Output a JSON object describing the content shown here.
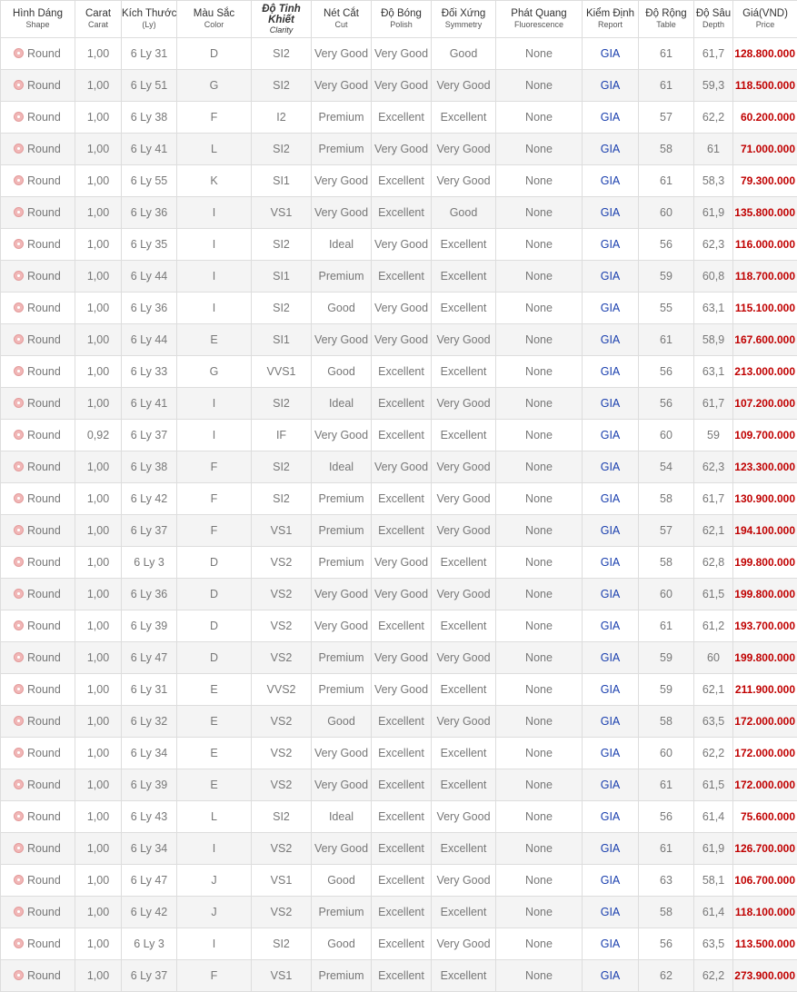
{
  "header": [
    {
      "main": "Hình Dáng",
      "sub": "Shape"
    },
    {
      "main": "Carat",
      "sub": "Carat"
    },
    {
      "main": "Kích Thước",
      "sub": "(Ly)"
    },
    {
      "main": "Màu Sắc",
      "sub": "Color"
    },
    {
      "main": "Độ Tinh Khiết",
      "sub": "Clarity"
    },
    {
      "main": "Nét Cắt",
      "sub": "Cut"
    },
    {
      "main": "Độ Bóng",
      "sub": "Polish"
    },
    {
      "main": "Đối Xứng",
      "sub": "Symmetry"
    },
    {
      "main": "Phát Quang",
      "sub": "Fluorescence"
    },
    {
      "main": "Kiểm Định",
      "sub": "Report"
    },
    {
      "main": "Độ Rộng",
      "sub": "Table"
    },
    {
      "main": "Độ Sâu",
      "sub": "Depth"
    },
    {
      "main": "Giá(VND)",
      "sub": "Price"
    }
  ],
  "rows": [
    {
      "shape": "Round",
      "carat": "1,00",
      "size": "6 Ly 31",
      "color": "D",
      "clarity": "SI2",
      "cut": "Very Good",
      "polish": "Very Good",
      "symmetry": "Good",
      "fluorescence": "None",
      "report": "GIA",
      "table": "61",
      "depth": "61,7",
      "price": "128.800.000"
    },
    {
      "shape": "Round",
      "carat": "1,00",
      "size": "6 Ly 51",
      "color": "G",
      "clarity": "SI2",
      "cut": "Very Good",
      "polish": "Very Good",
      "symmetry": "Very Good",
      "fluorescence": "None",
      "report": "GIA",
      "table": "61",
      "depth": "59,3",
      "price": "118.500.000"
    },
    {
      "shape": "Round",
      "carat": "1,00",
      "size": "6 Ly 38",
      "color": "F",
      "clarity": "I2",
      "cut": "Premium",
      "polish": "Excellent",
      "symmetry": "Excellent",
      "fluorescence": "None",
      "report": "GIA",
      "table": "57",
      "depth": "62,2",
      "price": "60.200.000"
    },
    {
      "shape": "Round",
      "carat": "1,00",
      "size": "6 Ly 41",
      "color": "L",
      "clarity": "SI2",
      "cut": "Premium",
      "polish": "Very Good",
      "symmetry": "Very Good",
      "fluorescence": "None",
      "report": "GIA",
      "table": "58",
      "depth": "61",
      "price": "71.000.000"
    },
    {
      "shape": "Round",
      "carat": "1,00",
      "size": "6 Ly 55",
      "color": "K",
      "clarity": "SI1",
      "cut": "Very Good",
      "polish": "Excellent",
      "symmetry": "Very Good",
      "fluorescence": "None",
      "report": "GIA",
      "table": "61",
      "depth": "58,3",
      "price": "79.300.000"
    },
    {
      "shape": "Round",
      "carat": "1,00",
      "size": "6 Ly 36",
      "color": "I",
      "clarity": "VS1",
      "cut": "Very Good",
      "polish": "Excellent",
      "symmetry": "Good",
      "fluorescence": "None",
      "report": "GIA",
      "table": "60",
      "depth": "61,9",
      "price": "135.800.000"
    },
    {
      "shape": "Round",
      "carat": "1,00",
      "size": "6 Ly 35",
      "color": "I",
      "clarity": "SI2",
      "cut": "Ideal",
      "polish": "Very Good",
      "symmetry": "Excellent",
      "fluorescence": "None",
      "report": "GIA",
      "table": "56",
      "depth": "62,3",
      "price": "116.000.000"
    },
    {
      "shape": "Round",
      "carat": "1,00",
      "size": "6 Ly 44",
      "color": "I",
      "clarity": "SI1",
      "cut": "Premium",
      "polish": "Excellent",
      "symmetry": "Excellent",
      "fluorescence": "None",
      "report": "GIA",
      "table": "59",
      "depth": "60,8",
      "price": "118.700.000"
    },
    {
      "shape": "Round",
      "carat": "1,00",
      "size": "6 Ly 36",
      "color": "I",
      "clarity": "SI2",
      "cut": "Good",
      "polish": "Very Good",
      "symmetry": "Excellent",
      "fluorescence": "None",
      "report": "GIA",
      "table": "55",
      "depth": "63,1",
      "price": "115.100.000"
    },
    {
      "shape": "Round",
      "carat": "1,00",
      "size": "6 Ly 44",
      "color": "E",
      "clarity": "SI1",
      "cut": "Very Good",
      "polish": "Very Good",
      "symmetry": "Very Good",
      "fluorescence": "None",
      "report": "GIA",
      "table": "61",
      "depth": "58,9",
      "price": "167.600.000"
    },
    {
      "shape": "Round",
      "carat": "1,00",
      "size": "6 Ly 33",
      "color": "G",
      "clarity": "VVS1",
      "cut": "Good",
      "polish": "Excellent",
      "symmetry": "Excellent",
      "fluorescence": "None",
      "report": "GIA",
      "table": "56",
      "depth": "63,1",
      "price": "213.000.000"
    },
    {
      "shape": "Round",
      "carat": "1,00",
      "size": "6 Ly 41",
      "color": "I",
      "clarity": "SI2",
      "cut": "Ideal",
      "polish": "Excellent",
      "symmetry": "Very Good",
      "fluorescence": "None",
      "report": "GIA",
      "table": "56",
      "depth": "61,7",
      "price": "107.200.000"
    },
    {
      "shape": "Round",
      "carat": "0,92",
      "size": "6 Ly 37",
      "color": "I",
      "clarity": "IF",
      "cut": "Very Good",
      "polish": "Excellent",
      "symmetry": "Excellent",
      "fluorescence": "None",
      "report": "GIA",
      "table": "60",
      "depth": "59",
      "price": "109.700.000"
    },
    {
      "shape": "Round",
      "carat": "1,00",
      "size": "6 Ly 38",
      "color": "F",
      "clarity": "SI2",
      "cut": "Ideal",
      "polish": "Very Good",
      "symmetry": "Very Good",
      "fluorescence": "None",
      "report": "GIA",
      "table": "54",
      "depth": "62,3",
      "price": "123.300.000"
    },
    {
      "shape": "Round",
      "carat": "1,00",
      "size": "6 Ly 42",
      "color": "F",
      "clarity": "SI2",
      "cut": "Premium",
      "polish": "Excellent",
      "symmetry": "Very Good",
      "fluorescence": "None",
      "report": "GIA",
      "table": "58",
      "depth": "61,7",
      "price": "130.900.000"
    },
    {
      "shape": "Round",
      "carat": "1,00",
      "size": "6 Ly 37",
      "color": "F",
      "clarity": "VS1",
      "cut": "Premium",
      "polish": "Excellent",
      "symmetry": "Very Good",
      "fluorescence": "None",
      "report": "GIA",
      "table": "57",
      "depth": "62,1",
      "price": "194.100.000"
    },
    {
      "shape": "Round",
      "carat": "1,00",
      "size": "6 Ly 3",
      "color": "D",
      "clarity": "VS2",
      "cut": "Premium",
      "polish": "Very Good",
      "symmetry": "Excellent",
      "fluorescence": "None",
      "report": "GIA",
      "table": "58",
      "depth": "62,8",
      "price": "199.800.000"
    },
    {
      "shape": "Round",
      "carat": "1,00",
      "size": "6 Ly 36",
      "color": "D",
      "clarity": "VS2",
      "cut": "Very Good",
      "polish": "Very Good",
      "symmetry": "Very Good",
      "fluorescence": "None",
      "report": "GIA",
      "table": "60",
      "depth": "61,5",
      "price": "199.800.000"
    },
    {
      "shape": "Round",
      "carat": "1,00",
      "size": "6 Ly 39",
      "color": "D",
      "clarity": "VS2",
      "cut": "Very Good",
      "polish": "Excellent",
      "symmetry": "Excellent",
      "fluorescence": "None",
      "report": "GIA",
      "table": "61",
      "depth": "61,2",
      "price": "193.700.000"
    },
    {
      "shape": "Round",
      "carat": "1,00",
      "size": "6 Ly 47",
      "color": "D",
      "clarity": "VS2",
      "cut": "Premium",
      "polish": "Very Good",
      "symmetry": "Very Good",
      "fluorescence": "None",
      "report": "GIA",
      "table": "59",
      "depth": "60",
      "price": "199.800.000"
    },
    {
      "shape": "Round",
      "carat": "1,00",
      "size": "6 Ly 31",
      "color": "E",
      "clarity": "VVS2",
      "cut": "Premium",
      "polish": "Very Good",
      "symmetry": "Excellent",
      "fluorescence": "None",
      "report": "GIA",
      "table": "59",
      "depth": "62,1",
      "price": "211.900.000"
    },
    {
      "shape": "Round",
      "carat": "1,00",
      "size": "6 Ly 32",
      "color": "E",
      "clarity": "VS2",
      "cut": "Good",
      "polish": "Excellent",
      "symmetry": "Very Good",
      "fluorescence": "None",
      "report": "GIA",
      "table": "58",
      "depth": "63,5",
      "price": "172.000.000"
    },
    {
      "shape": "Round",
      "carat": "1,00",
      "size": "6 Ly 34",
      "color": "E",
      "clarity": "VS2",
      "cut": "Very Good",
      "polish": "Excellent",
      "symmetry": "Excellent",
      "fluorescence": "None",
      "report": "GIA",
      "table": "60",
      "depth": "62,2",
      "price": "172.000.000"
    },
    {
      "shape": "Round",
      "carat": "1,00",
      "size": "6 Ly 39",
      "color": "E",
      "clarity": "VS2",
      "cut": "Very Good",
      "polish": "Excellent",
      "symmetry": "Excellent",
      "fluorescence": "None",
      "report": "GIA",
      "table": "61",
      "depth": "61,5",
      "price": "172.000.000"
    },
    {
      "shape": "Round",
      "carat": "1,00",
      "size": "6 Ly 43",
      "color": "L",
      "clarity": "SI2",
      "cut": "Ideal",
      "polish": "Excellent",
      "symmetry": "Very Good",
      "fluorescence": "None",
      "report": "GIA",
      "table": "56",
      "depth": "61,4",
      "price": "75.600.000"
    },
    {
      "shape": "Round",
      "carat": "1,00",
      "size": "6 Ly 34",
      "color": "I",
      "clarity": "VS2",
      "cut": "Very Good",
      "polish": "Excellent",
      "symmetry": "Excellent",
      "fluorescence": "None",
      "report": "GIA",
      "table": "61",
      "depth": "61,9",
      "price": "126.700.000"
    },
    {
      "shape": "Round",
      "carat": "1,00",
      "size": "6 Ly 47",
      "color": "J",
      "clarity": "VS1",
      "cut": "Good",
      "polish": "Excellent",
      "symmetry": "Very Good",
      "fluorescence": "None",
      "report": "GIA",
      "table": "63",
      "depth": "58,1",
      "price": "106.700.000"
    },
    {
      "shape": "Round",
      "carat": "1,00",
      "size": "6 Ly 42",
      "color": "J",
      "clarity": "VS2",
      "cut": "Premium",
      "polish": "Excellent",
      "symmetry": "Excellent",
      "fluorescence": "None",
      "report": "GIA",
      "table": "58",
      "depth": "61,4",
      "price": "118.100.000"
    },
    {
      "shape": "Round",
      "carat": "1,00",
      "size": "6 Ly 3",
      "color": "I",
      "clarity": "SI2",
      "cut": "Good",
      "polish": "Excellent",
      "symmetry": "Very Good",
      "fluorescence": "None",
      "report": "GIA",
      "table": "56",
      "depth": "63,5",
      "price": "113.500.000"
    },
    {
      "shape": "Round",
      "carat": "1,00",
      "size": "6 Ly 37",
      "color": "F",
      "clarity": "VS1",
      "cut": "Premium",
      "polish": "Excellent",
      "symmetry": "Excellent",
      "fluorescence": "None",
      "report": "GIA",
      "table": "62",
      "depth": "62,2",
      "price": "273.900.000"
    }
  ],
  "icons": {
    "shape": "round-diamond-icon"
  },
  "colors": {
    "price": "#c00000",
    "report_link": "#1a3fae",
    "row_alt": "#f4f4f4"
  }
}
